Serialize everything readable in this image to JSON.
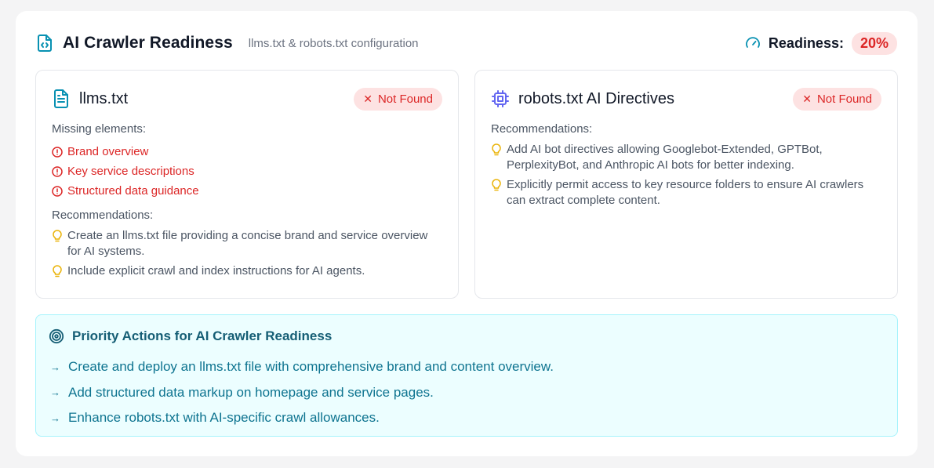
{
  "header": {
    "title": "AI Crawler Readiness",
    "subtitle": "llms.txt & robots.txt configuration",
    "readiness_label": "Readiness:",
    "readiness_value": "20%"
  },
  "llms": {
    "title": "llms.txt",
    "status": "Not Found",
    "missing_label": "Missing elements:",
    "missing": [
      "Brand overview",
      "Key service descriptions",
      "Structured data guidance"
    ],
    "rec_label": "Recommendations:",
    "recommendations": [
      "Create an llms.txt file providing a concise brand and service overview for AI systems.",
      "Include explicit crawl and index instructions for AI agents."
    ]
  },
  "robots": {
    "title": "robots.txt AI Directives",
    "status": "Not Found",
    "rec_label": "Recommendations:",
    "recommendations": [
      "Add AI bot directives allowing Googlebot-Extended, GPTBot, PerplexityBot, and Anthropic AI bots for better indexing.",
      "Explicitly permit access to key resource folders to ensure AI crawlers can extract complete content."
    ]
  },
  "priority": {
    "title": "Priority Actions for AI Crawler Readiness",
    "actions": [
      "Create and deploy an llms.txt file with comprehensive brand and content overview.",
      "Add structured data markup on homepage and service pages.",
      "Enhance robots.txt with AI-specific crawl allowances."
    ]
  },
  "icons": {
    "header": "file-code-icon",
    "readiness": "gauge-icon",
    "llms": "file-text-icon",
    "robots": "cpu-icon",
    "missing": "alert-circle-icon",
    "recommendation": "lightbulb-icon",
    "priority": "target-icon",
    "action": "arrow-right-icon",
    "status": "x-icon"
  },
  "colors": {
    "accent": "#0891b2",
    "danger": "#dc2626",
    "danger_bg": "#fde2e2",
    "bulb": "#eab308",
    "robots_icon": "#6366f1",
    "priority_bg": "#ecfeff"
  }
}
